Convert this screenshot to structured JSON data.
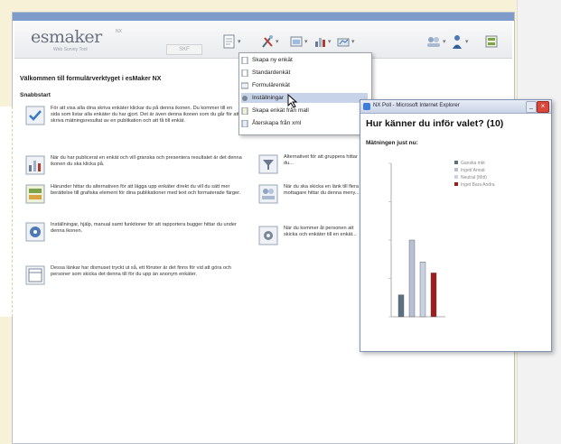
{
  "app": {
    "logo": "esmaker",
    "logo_sup": "NX",
    "logo_tagline": "Web Survey Tool",
    "nav_ghost": "SKF"
  },
  "toolbar": {
    "icons": [
      "new-document-icon",
      "tools-icon",
      "publish-icon",
      "results-icon",
      "analyze-icon",
      "users-icon",
      "person-icon",
      "export-icon"
    ]
  },
  "welcome": {
    "title": "Välkommen till formulärverktyget i esMaker NX",
    "section": "Snabbstart",
    "features": [
      {
        "icon": "checklist-icon",
        "text": "För att visa alla dina skriva enkäter klickar du på denna ikonen. Du kommer till en sida som listar alla enkäter du har gjort. Det är även denna ikonen som du går för att skriva mätningsresultat av en publikation och att få till enkät."
      },
      {
        "icon": "results-chart-icon",
        "text": "När du har publicerat en enkät och vill granska och presentera resultatet är det denna ikonen du ska klicka på."
      },
      {
        "icon": "export-icon",
        "text": "Härunder hittar du alternativen för att lägga upp enkäter direkt du vill du sätt mer berättelse till grafiska element för dina publikationer med text och formaterade färger."
      },
      {
        "icon": "settings-icon",
        "text": "Inställningar, hjälp, manual samt funktioner för att rapportera bugger hittar du under denna ikonen."
      },
      {
        "icon": "window-icon",
        "text": "Dessa länkar har dismuset tryckt ut så, ett fönster är det finns för vid att göra och personer som skicka det denna till för du upp än anonym enkäter."
      }
    ],
    "right_features": [
      {
        "icon": "filter-icon",
        "text": "Alternativet för att gruppera hittar du..."
      },
      {
        "icon": "users-list-icon",
        "text": "När du ska skicka en länk till flera mottagare hittar du denna meny..."
      },
      {
        "icon": "gear-icon",
        "text": "När du kommer åt personen att skicka och enkäter till en enkät..."
      }
    ]
  },
  "dropdown": {
    "items": [
      {
        "label": "Skapa ny enkät",
        "active": false
      },
      {
        "label": "Standardenkät",
        "active": false
      },
      {
        "label": "Formulärenkät",
        "active": false
      },
      {
        "label": "Inställningar",
        "active": true
      },
      {
        "label": "Skapa enkät från mall",
        "active": false
      },
      {
        "label": "Återskapa från xml",
        "active": false
      }
    ]
  },
  "popup": {
    "window_title": "NX Poll - Microsoft Internet Explorer",
    "question": "Hur känner du inför valet? (10)",
    "results_label": "Mätningen just nu:"
  },
  "chart_data": {
    "type": "bar",
    "categories": [
      "",
      "",
      "",
      ""
    ],
    "series": [
      {
        "name": "Ganska mkt",
        "values": [
          2,
          7,
          5,
          4
        ]
      }
    ],
    "bar_colors": [
      "#5b7083",
      "#b8c0d6",
      "#c8d0e4",
      "#a01b1b"
    ],
    "legend": [
      "Ganska mkt",
      "Inget/ Annat",
      "Neutral (Mitt)",
      "Inget Bara Andra"
    ],
    "legend_colors": [
      "#5b7083",
      "#b8c0d6",
      "#c8d0e4",
      "#a01b1b"
    ],
    "legend_placement": "top-right",
    "ylim": [
      0,
      14
    ],
    "grid": false,
    "xlabel": "",
    "ylabel": ""
  }
}
